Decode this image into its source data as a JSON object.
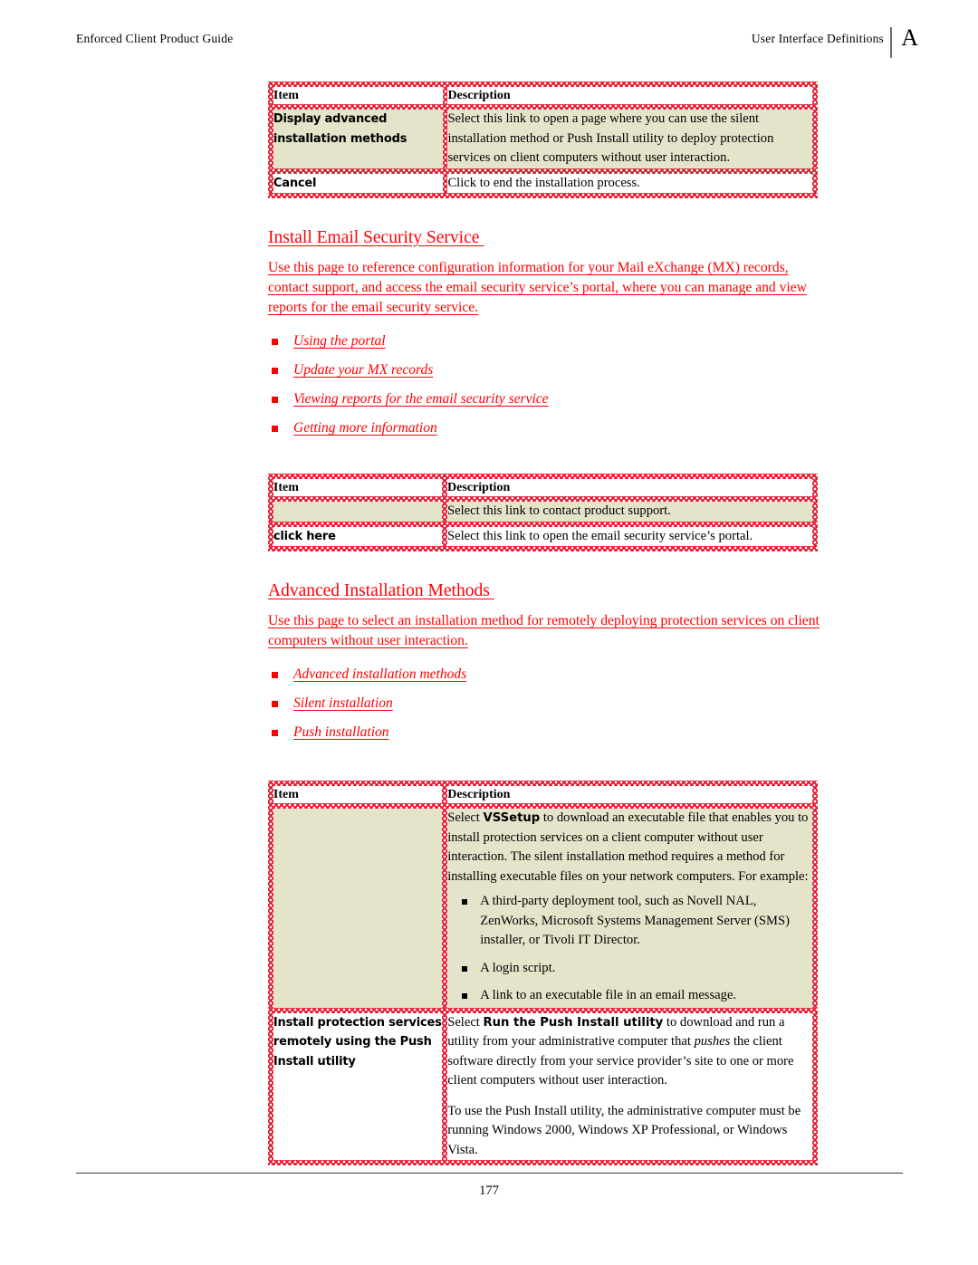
{
  "header": {
    "left_title": "Enforced Client Product Guide",
    "right_title": "User Interface Definitions",
    "appendix_letter": "A"
  },
  "footer": {
    "page_number": "177"
  },
  "table_headers": {
    "item": "Item",
    "description": "Description"
  },
  "table1": {
    "rows": [
      {
        "item": "Display advanced installation methods",
        "description": "Select this link to open a page where you can use the silent installation method or Push Install utility to deploy protection services on client computers without user interaction."
      },
      {
        "item": "Cancel",
        "description": "Click to end the installation process."
      }
    ]
  },
  "section1": {
    "heading": "Install Email Security Service ",
    "body": "Use this page to reference configuration information for your Mail eXchange (MX) records, contact support, and access the email security service’s portal, where you can manage and view reports for the email security service. ",
    "links": [
      "Using the portal",
      "Update your MX records",
      "Viewing reports for the email security service",
      "Getting more information"
    ]
  },
  "table2": {
    "rows": [
      {
        "item": "",
        "description": "Select this link to contact product support."
      },
      {
        "item": "click here",
        "description": "Select this link to open the email security service’s portal."
      }
    ]
  },
  "section2": {
    "heading": "Advanced Installation Methods ",
    "body": "Use this page to select an installation method for remotely deploying protection services on client computers without user interaction. ",
    "links": [
      "Advanced installation methods",
      "Silent installation",
      "Push installation"
    ]
  },
  "table3": {
    "row1": {
      "item": "",
      "desc_lead_1": "Select ",
      "desc_bold_1": "VSSetup",
      "desc_lead_2": " to download an executable file that enables you to install protection services on a client computer without user interaction. The silent installation method requires a method for installing executable files on your network computers. For example:",
      "bullets": [
        "A third-party deployment tool, such as Novell NAL, ZenWorks, Microsoft Systems Management Server (SMS) installer, or Tivoli IT Director.",
        "A login script.",
        "A link to an executable file in an email message."
      ]
    },
    "row2": {
      "item": "Install protection services remotely using the Push Install utility",
      "desc_lead_1": "Select ",
      "desc_bold_1": "Run the Push Install utility",
      "desc_lead_2": " to download and run a utility from your administrative computer that ",
      "desc_italic_1": "pushes",
      "desc_lead_3": " the client software directly from your service provider’s site to one or more client computers without user interaction.",
      "desc_para2": "To use the Push Install utility, the administrative computer must be running Windows 2000, Windows XP Professional, or Windows Vista."
    }
  },
  "colors": {
    "revision_red": "#ff0000",
    "hatch_red": "#e8132b",
    "highlight_olive": "#e4e4cb"
  }
}
